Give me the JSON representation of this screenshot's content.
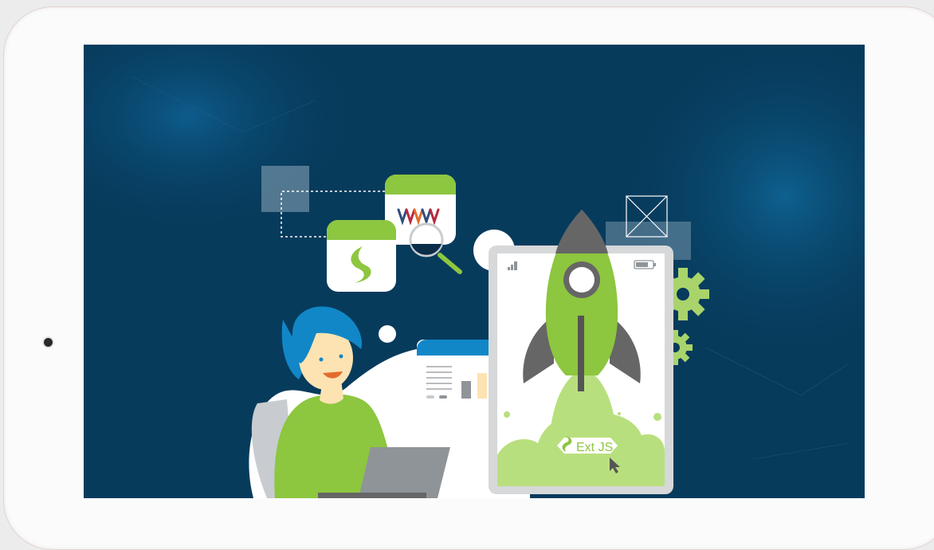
{
  "badge": {
    "label": "Ext JS"
  },
  "colors": {
    "screen_background": "#073b5c",
    "accent_green": "#8dc63f",
    "accent_blue": "#1187c7",
    "tablet_frame": "#fbfbfb"
  },
  "icons": [
    "sencha-logo-icon",
    "wavemaker-logo-icon",
    "magnifier-icon",
    "rocket-icon",
    "gear-icon",
    "cursor-arrow-icon",
    "battery-icon",
    "signal-icon",
    "image-placeholder-icon"
  ]
}
